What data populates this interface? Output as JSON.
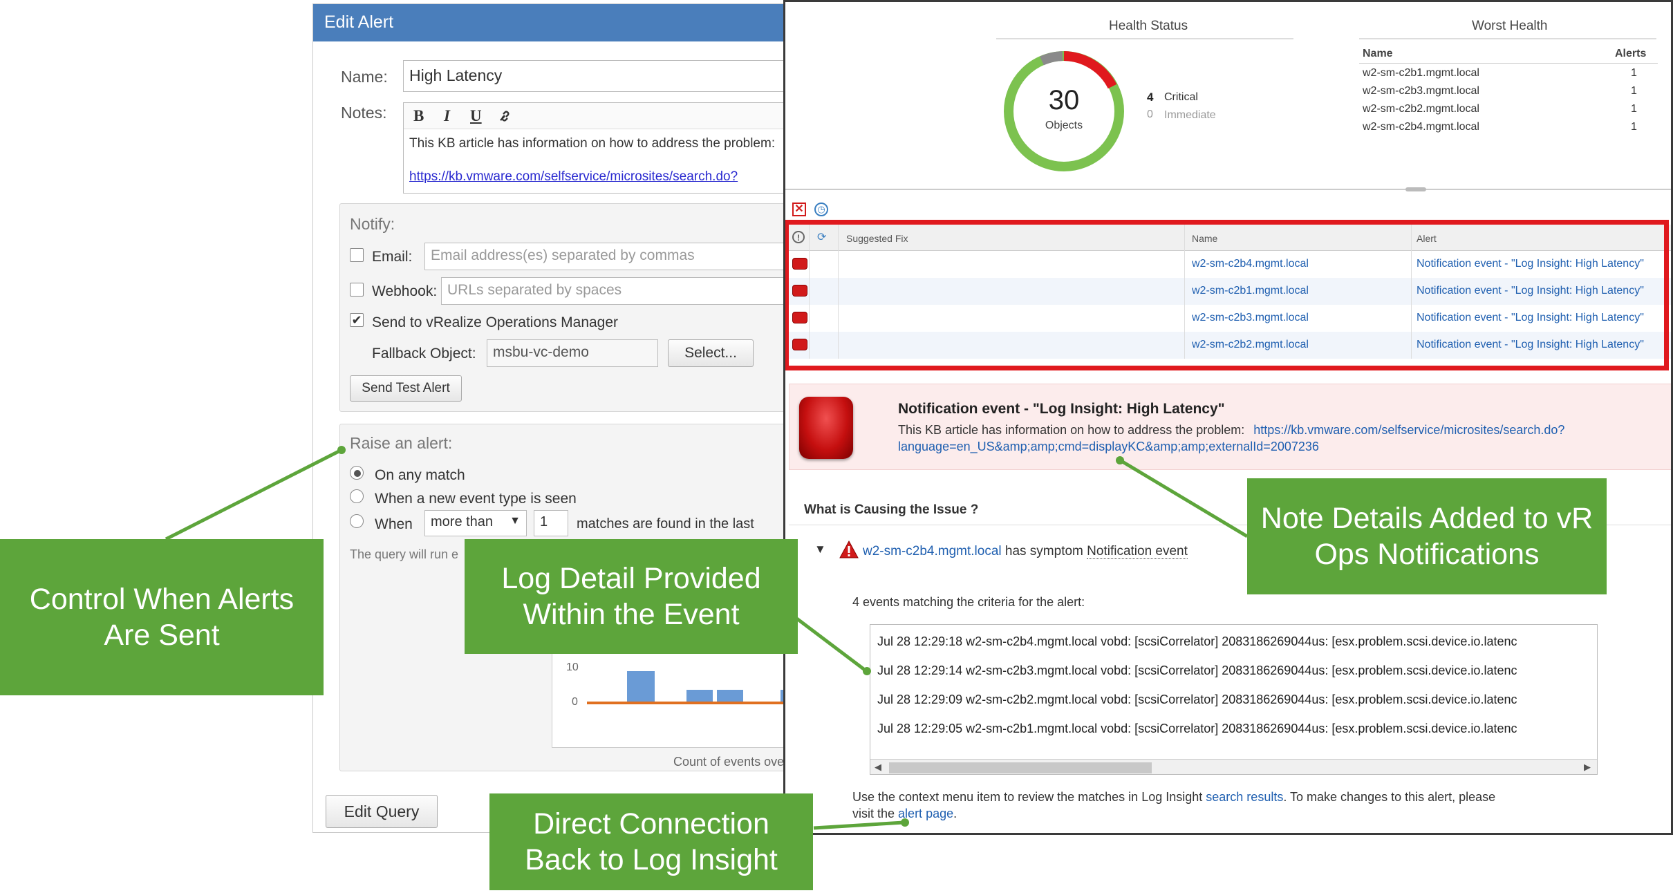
{
  "edit_alert": {
    "title": "Edit Alert",
    "name_label": "Name:",
    "name_value": "High Latency",
    "notes_label": "Notes:",
    "toolbar": {
      "bold": "B",
      "italic": "I",
      "underline": "U"
    },
    "notes_text": "This KB article has information on how to address the problem:",
    "notes_link": "https://kb.vmware.com/selfservice/microsites/search.do?",
    "notify": {
      "title": "Notify:",
      "email_label": "Email:",
      "email_placeholder": "Email address(es) separated by commas",
      "webhook_label": "Webhook:",
      "webhook_placeholder": "URLs separated by spaces",
      "vrops_label": "Send to vRealize Operations Manager",
      "fallback_label": "Fallback Object:",
      "fallback_value": "msbu-vc-demo",
      "select_button": "Select...",
      "test_button": "Send Test Alert"
    },
    "raise": {
      "title": "Raise an alert:",
      "option_any": "On any match",
      "option_new": "When a new event type is seen",
      "option_when": "When",
      "comparator": "more than",
      "count_value": "1",
      "suffix": "matches are found in the last",
      "query_note": "The query will run e",
      "chart_tick_high": "10",
      "chart_tick_low": "0",
      "chart_caption": "Count of events ove"
    },
    "edit_query_button": "Edit Query"
  },
  "vrops": {
    "health_status": {
      "title": "Health Status",
      "count": "30",
      "unit": "Objects",
      "critical_count": "4",
      "critical_label": "Critical",
      "immediate_count": "0",
      "immediate_label": "Immediate"
    },
    "worst_health": {
      "title": "Worst Health",
      "col_name": "Name",
      "col_alerts": "Alerts",
      "rows": [
        {
          "name": "w2-sm-c2b1.mgmt.local",
          "alerts": "1"
        },
        {
          "name": "w2-sm-c2b3.mgmt.local",
          "alerts": "1"
        },
        {
          "name": "w2-sm-c2b2.mgmt.local",
          "alerts": "1"
        },
        {
          "name": "w2-sm-c2b4.mgmt.local",
          "alerts": "1"
        }
      ]
    },
    "alerts_table": {
      "col_fix": "Suggested Fix",
      "col_name": "Name",
      "col_alert": "Alert",
      "rows": [
        {
          "name": "w2-sm-c2b4.mgmt.local",
          "alert": "Notification event - \"Log Insight: High Latency\""
        },
        {
          "name": "w2-sm-c2b1.mgmt.local",
          "alert": "Notification event - \"Log Insight: High Latency\""
        },
        {
          "name": "w2-sm-c2b3.mgmt.local",
          "alert": "Notification event - \"Log Insight: High Latency\""
        },
        {
          "name": "w2-sm-c2b2.mgmt.local",
          "alert": "Notification event - \"Log Insight: High Latency\""
        }
      ]
    },
    "notification": {
      "title": "Notification event - \"Log Insight: High Latency\"",
      "text": "This KB article has information on how to address the problem:",
      "link_line1": "https://kb.vmware.com/selfservice/microsites/search.do?",
      "link_line2": "language=en_US&amp;amp;cmd=displayKC&amp;amp;externalId=2007236"
    },
    "cause": {
      "title": "What is Causing the Issue ?",
      "host": "w2-sm-c2b4.mgmt.local",
      "has_symptom": "has symptom",
      "symptom": "Notification event",
      "events_header": "4 events matching the criteria for the alert:",
      "events": [
        "Jul 28 12:29:18 w2-sm-c2b4.mgmt.local vobd: [scsiCorrelator] 2083186269044us: [esx.problem.scsi.device.io.latenc",
        "Jul 28 12:29:14 w2-sm-c2b3.mgmt.local vobd: [scsiCorrelator] 2083186269044us: [esx.problem.scsi.device.io.latenc",
        "Jul 28 12:29:09 w2-sm-c2b2.mgmt.local vobd: [scsiCorrelator] 2083186269044us: [esx.problem.scsi.device.io.latenc",
        "Jul 28 12:29:05 w2-sm-c2b1.mgmt.local vobd: [scsiCorrelator] 2083186269044us: [esx.problem.scsi.device.io.latenc"
      ],
      "footer_text": "Use the context menu item to review the matches in Log Insight",
      "footer_link": "search results",
      "footer_text2": ". To make changes to this alert, please",
      "footer_text3": "visit the",
      "footer_link2": "alert page",
      "footer_end": "."
    }
  },
  "callouts": {
    "control": "Control When Alerts Are Sent",
    "log_detail": "Log Detail Provided Within the Event",
    "note_details": "Note Details Added to vR Ops Notifications",
    "direct": "Direct Connection Back to Log Insight"
  },
  "colors": {
    "callout_green": "#5da53b",
    "highlight_red": "#e0191e",
    "header_blue": "#4a7ebb",
    "link_blue": "#1f5fb0"
  }
}
